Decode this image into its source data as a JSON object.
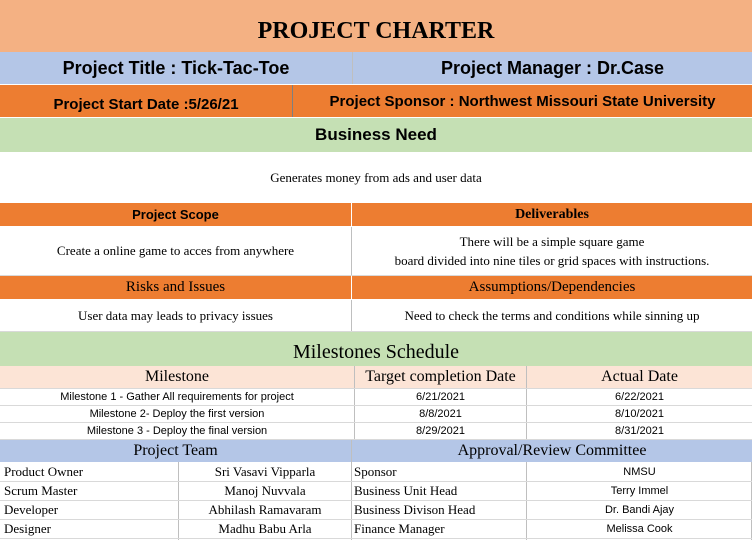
{
  "title": "PROJECT CHARTER",
  "project_title": "Project Title : Tick-Tac-Toe",
  "project_manager": "Project Manager : Dr.Case",
  "start_date": "Project Start Date :5/26/21",
  "sponsor": "Project Sponsor : Northwest Missouri State University",
  "business_need": {
    "heading": "Business Need",
    "text": "Generates money from ads and user data"
  },
  "scope": {
    "heading": "Project Scope",
    "text": "Create a online game to acces from anywhere"
  },
  "deliverables": {
    "heading": "Deliverables",
    "line1": "There will be a simple square game",
    "line2": "board divided into nine tiles or grid spaces with instructions."
  },
  "risks": {
    "heading": "Risks and Issues",
    "text": "User data may leads to privacy issues"
  },
  "assumptions": {
    "heading": "Assumptions/Dependencies",
    "text": "Need to check the terms and conditions while sinning up"
  },
  "milestones": {
    "heading": "Milestones Schedule",
    "columns": [
      "Milestone",
      "Target completion Date",
      "Actual Date"
    ],
    "rows": [
      {
        "name": "Milestone 1 - Gather All requirements for project",
        "target": "6/21/2021",
        "actual": "6/22/2021"
      },
      {
        "name": "Milestone 2- Deploy the first version",
        "target": "8/8/2021",
        "actual": "8/10/2021"
      },
      {
        "name": "Milestone 3 - Deploy the final version",
        "target": "8/29/2021",
        "actual": "8/31/2021"
      }
    ]
  },
  "team": {
    "heading": "Project Team",
    "rows": [
      {
        "role": "Product Owner",
        "name": "Sri Vasavi Vipparla"
      },
      {
        "role": "Scrum Master",
        "name": "Manoj Nuvvala"
      },
      {
        "role": "Developer",
        "name": "Abhilash Ramavaram"
      },
      {
        "role": "Designer",
        "name": "Madhu Babu Arla"
      }
    ]
  },
  "committee": {
    "heading": "Approval/Review Committee",
    "rows": [
      {
        "role": "Sponsor",
        "name": "NMSU"
      },
      {
        "role": "Business Unit Head",
        "name": "Terry Immel"
      },
      {
        "role": "Business Divison Head",
        "name": "Dr. Bandi Ajay"
      },
      {
        "role": "Finance Manager",
        "name": "Melissa Cook"
      }
    ]
  },
  "colors": {
    "salmon": "#f4b183",
    "blue": "#b4c6e7",
    "orange": "#ed7d31",
    "green": "#c5e0b4",
    "peach": "#fce4d6"
  }
}
